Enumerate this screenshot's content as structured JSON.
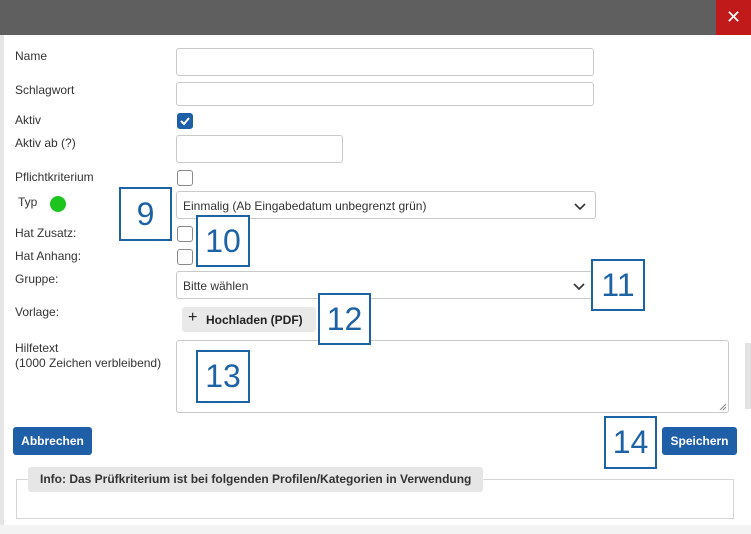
{
  "dialog": {
    "close_symbol": "✕"
  },
  "form": {
    "name_label": "Name",
    "schlagwort_label": "Schlagwort",
    "aktiv_label": "Aktiv",
    "aktiv_checked": true,
    "aktiv_ab_label": "Aktiv ab (?)",
    "pflicht_label": "Pflichtkriterium",
    "pflicht_checked": false,
    "typ_label": "Typ",
    "typ_status_color": "#1ec41e",
    "typ_value": "Einmalig (Ab Eingabedatum unbegrenzt grün)",
    "hat_zusatz_label": "Hat Zusatz:",
    "hat_anhang_label": "Hat Anhang:",
    "gruppe_label": "Gruppe:",
    "gruppe_value": "Bitte wählen",
    "vorlage_label": "Vorlage:",
    "upload_label": "Hochladen (PDF)",
    "upload_icon": "+",
    "hilfetext_label": "Hilfetext",
    "hilfetext_remaining": "(1000 Zeichen verbleibend)"
  },
  "annotations": [
    "9",
    "10",
    "11",
    "12",
    "13",
    "14"
  ],
  "buttons": {
    "cancel": "Abbrechen",
    "save": "Speichern"
  },
  "info": {
    "text": "Info: Das Prüfkriterium ist bei folgenden Profilen/Kategorien in Verwendung"
  },
  "colors": {
    "primary": "#1f5fa8",
    "close": "#c11a1a",
    "titlebar": "#5f5f5f"
  }
}
